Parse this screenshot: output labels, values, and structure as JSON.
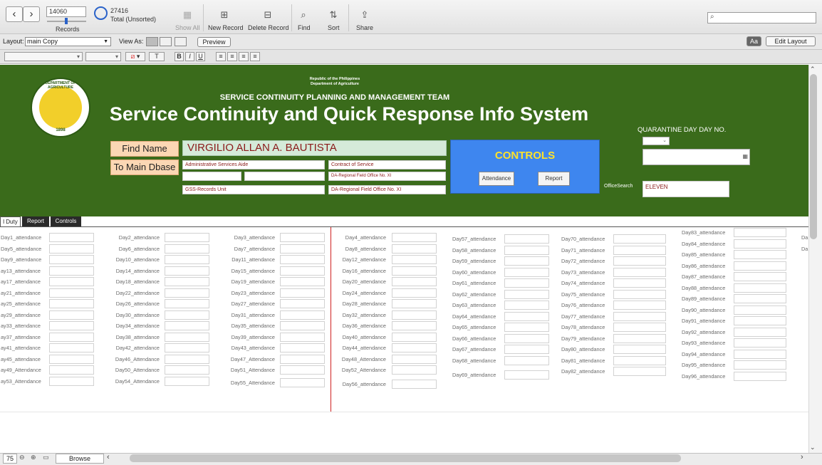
{
  "toolbar": {
    "record_number": "14060",
    "records_label": "Records",
    "total_count": "27416",
    "total_label": "Total (Unsorted)",
    "show_all": "Show All",
    "new_record": "New Record",
    "delete_record": "Delete Record",
    "find": "Find",
    "sort": "Sort",
    "share": "Share"
  },
  "layout_bar": {
    "layout_label": "Layout:",
    "layout_value": "main Copy",
    "view_as_label": "View As:",
    "preview": "Preview",
    "aa": "Aa",
    "edit_layout": "Edit Layout"
  },
  "format_bar": {
    "text_button": "T",
    "bold": "B",
    "italic": "I",
    "underline": "U"
  },
  "header": {
    "republic": "Republic of the Philippines",
    "department": "Department of Agriculture",
    "team": "SERVICE CONTINUITY PLANNING AND MANAGEMENT TEAM",
    "title": "Service Continuity and Quick Response Info System",
    "seal_top": "DEPARTMENT OF AGRICULTURE",
    "seal_year": "1898",
    "quarantine_label": "QUARANTINE DAY DAY NO."
  },
  "person": {
    "find_name_button": "Find Name",
    "main_dbase_button": "To Main Dbase",
    "name": "VIRGILIO ALLAN A. BAUTISTA",
    "position": "Administrative Services Aide",
    "employment": "Contract of  Service",
    "office_small": "DA-Regional Field Office  No. XI",
    "unit": "GSS-Records Unit",
    "office": "DA-Regional Field Office  No. XI"
  },
  "controls": {
    "title": "CONTROLS",
    "attendance": "Attendance",
    "report": "Report"
  },
  "office_search": {
    "label": "OfficeSearch",
    "value": "ELEVEN"
  },
  "tabs": [
    {
      "label": "l Duty",
      "active": true
    },
    {
      "label": "Report",
      "active": false
    },
    {
      "label": "Controls",
      "active": false
    }
  ],
  "attendance": {
    "col1": [
      "Day1_attendance",
      "Day5_attendance",
      "Day9_attendance",
      "ay13_attendance",
      "ay17_attendance",
      "ay21_attendance",
      "ay25_attendance",
      "ay29_attendance",
      "ay33_attendance",
      "ay37_attendance",
      "ay41_attendance",
      "ay45_attendance",
      "ay49_Attendance",
      "ay53_Attendance"
    ],
    "col2": [
      "Day2_attendance",
      "Day6_attendance",
      "Day10_attendance",
      "Day14_attendance",
      "Day18_attendance",
      "Day22_attendance",
      "Day26_attendance",
      "Day30_attendance",
      "Day34_attendance",
      "Day38_attendance",
      "Day42_attendance",
      "Day46_Attendance",
      "Day50_Attendance",
      "Day54_Attendance"
    ],
    "col3": [
      "Day3_attendance",
      "Day7_attendance",
      "Day11_attendance",
      "Day15_attendance",
      "Day19_attendance",
      "Day23_attendance",
      "Day27_attendance",
      "Day31_attendance",
      "Day35_attendance",
      "Day39_attendance",
      "Day43_attendance",
      "Day47_Attendance",
      "Day51_Attendance",
      "Day55_Attendance"
    ],
    "col4": [
      "Day4_attendance",
      "Day8_attendance",
      "Day12_attendance",
      "Day16_attendance",
      "Day20_attendance",
      "Day24_attendance",
      "Day28_attendance",
      "Day32_attendance",
      "Day36_attendance",
      "Day40_attendance",
      "Day44_attendance",
      "Day48_Attendance",
      "Day52_Attendance",
      "Day56_attendance"
    ],
    "col5": [
      "Day57_attendance",
      "Day58_attendance",
      "Day59_attendance",
      "Day60_attendance",
      "Day61_attendance",
      "Day62_attendance",
      "Day63_attendance",
      "Day64_attendance",
      "Day65_attendance",
      "Day66_attendance",
      "Day67_attendance",
      "Day68_attendance",
      "Day69_attendance"
    ],
    "col6": [
      "Day70_attendance",
      "Day71_attendance",
      "Day72_attendance",
      "Day73_attendance",
      "Day74_attendance",
      "Day75_attendance",
      "Day76_attendance",
      "Day77_attendance",
      "Day78_attendance",
      "Day79_attendance",
      "Day80_attendance",
      "Day81_attendance",
      "Day82_attendance"
    ],
    "col7": [
      "Day83_attendance",
      "Day84_attendance",
      "Day85_attendance",
      "Day86_attendance",
      "Day87_attendance",
      "Day88_attendance",
      "Day89_attendance",
      "Day90_attendance",
      "Day91_attendance",
      "Day92_attendance",
      "Day93_attendance",
      "Day94_attendance",
      "Day95_attendance",
      "Day96_attendance"
    ],
    "col8": [
      "Da",
      "Da"
    ]
  },
  "status": {
    "zoom": "75",
    "mode": "Browse"
  }
}
